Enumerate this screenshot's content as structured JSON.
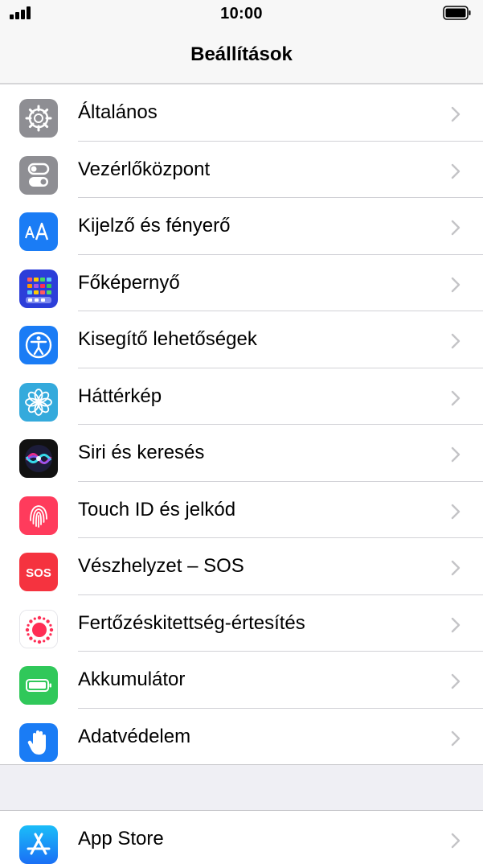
{
  "status_bar": {
    "time": "10:00"
  },
  "nav": {
    "title": "Beállítások"
  },
  "settings_items": [
    {
      "label": "Általános",
      "icon": "gear-icon",
      "color": "#8e8e93"
    },
    {
      "label": "Vezérlőközpont",
      "icon": "toggles-icon",
      "color": "#8e8e93"
    },
    {
      "label": "Kijelző és fényerő",
      "icon": "text-size-icon",
      "color": "#1a7cf5"
    },
    {
      "label": "Főképernyő",
      "icon": "home-screen-icon",
      "color": "#2c3ed9"
    },
    {
      "label": "Kisegítő lehetőségek",
      "icon": "accessibility-icon",
      "color": "#1a7cf5"
    },
    {
      "label": "Háttérkép",
      "icon": "flower-icon",
      "color": "#34aadc"
    },
    {
      "label": "Siri és keresés",
      "icon": "siri-icon",
      "color": "#222222"
    },
    {
      "label": "Touch ID és jelkód",
      "icon": "fingerprint-icon",
      "color": "#ff3b5c"
    },
    {
      "label": "Vészhelyzet – SOS",
      "icon": "sos-icon",
      "color": "#f5333f"
    },
    {
      "label": "Fertőzéskitettség-értesítés",
      "icon": "exposure-icon",
      "color": "#ff2d55"
    },
    {
      "label": "Akkumulátor",
      "icon": "battery-icon",
      "color": "#30c85a"
    },
    {
      "label": "Adatvédelem",
      "icon": "hand-icon",
      "color": "#1a7cf5"
    }
  ],
  "store_items": [
    {
      "label": "App Store",
      "icon": "app-store-icon",
      "color": "#1a8cf9"
    }
  ],
  "icon_texts": {
    "sos": "SOS"
  }
}
